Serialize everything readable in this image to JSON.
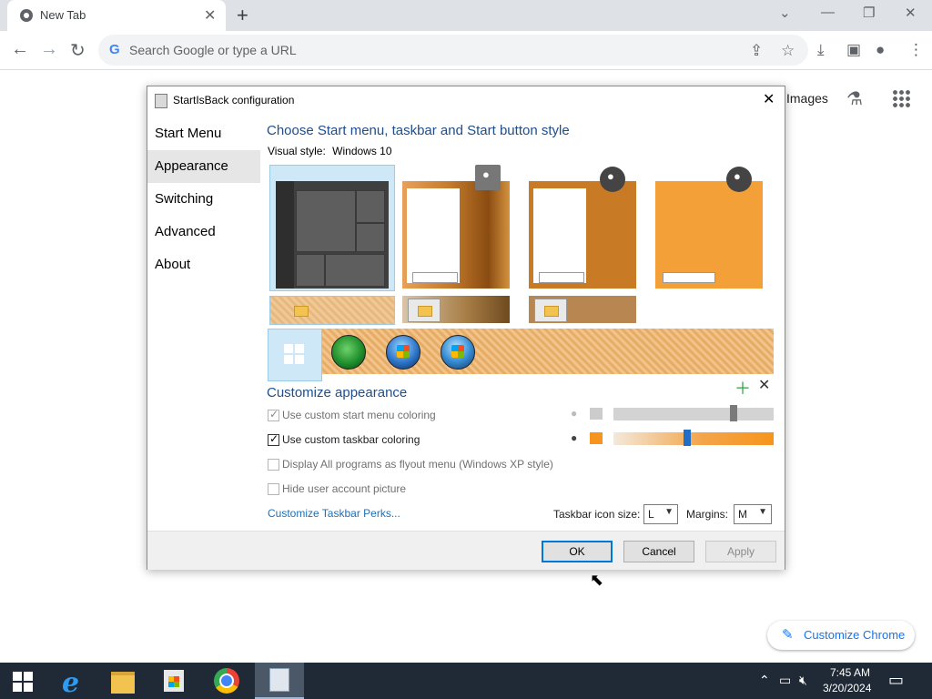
{
  "browser": {
    "tab_title": "New Tab",
    "omnibox_placeholder": "Search Google or type a URL",
    "ntp_images_link": "Images",
    "customize_chrome_label": "Customize Chrome"
  },
  "dialog": {
    "title": "StartIsBack configuration",
    "nav": [
      {
        "label": "Start Menu"
      },
      {
        "label": "Appearance"
      },
      {
        "label": "Switching"
      },
      {
        "label": "Advanced"
      },
      {
        "label": "About"
      }
    ],
    "selected_nav": "Appearance",
    "style_title": "Choose Start menu, taskbar and Start button style",
    "visual_style_label": "Visual style:",
    "visual_style_value": "Windows 10",
    "customize_title": "Customize appearance",
    "options": [
      {
        "label": "Use custom start menu coloring",
        "checked": true,
        "enabled": false
      },
      {
        "label": "Use custom taskbar coloring",
        "checked": true,
        "enabled": true
      },
      {
        "label": "Display All programs as flyout menu (Windows XP style)",
        "checked": false,
        "enabled": false
      },
      {
        "label": "Hide user account picture",
        "checked": false,
        "enabled": false
      }
    ],
    "start_menu_color": "#cccccc",
    "taskbar_color": "#f7941d",
    "start_menu_slider_level": 0.75,
    "taskbar_slider_level": 0.46,
    "perks_link": "Customize Taskbar Perks...",
    "icon_size_label": "Taskbar icon size:",
    "icon_size_value": "L",
    "margins_label": "Margins:",
    "margins_value": "M",
    "buttons": {
      "ok": "OK",
      "cancel": "Cancel",
      "apply": "Apply"
    }
  },
  "taskbar": {
    "time": "7:45 AM",
    "date": "3/20/2024"
  }
}
